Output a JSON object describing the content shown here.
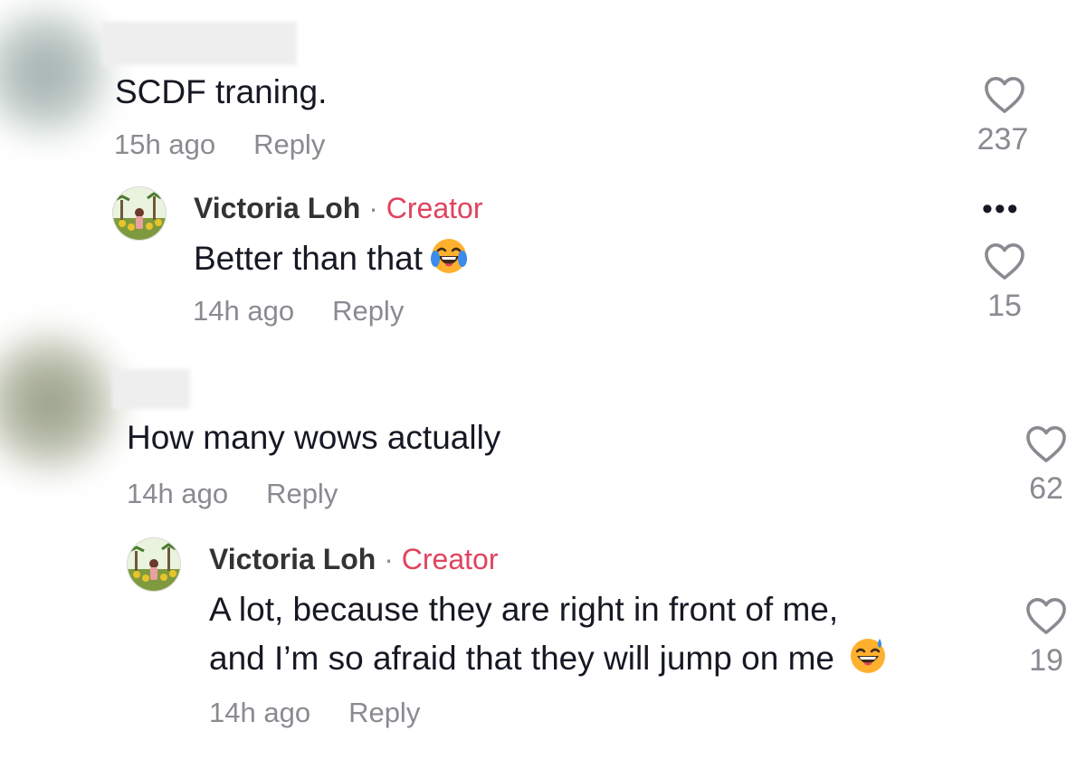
{
  "comments": [
    {
      "text": "SCDF traning.",
      "time": "15h ago",
      "reply_label": "Reply",
      "likes": "237",
      "replies": [
        {
          "author": "Victoria Loh",
          "separator": "·",
          "badge": "Creator",
          "text": "Better than that",
          "emoji": "face-with-tears-of-joy",
          "time": "14h ago",
          "reply_label": "Reply",
          "likes": "15",
          "more": "•••"
        }
      ]
    },
    {
      "text": "How many wows actually",
      "time": "14h ago",
      "reply_label": "Reply",
      "likes": "62",
      "replies": [
        {
          "author": "Victoria Loh",
          "separator": "·",
          "badge": "Creator",
          "text_line1": "A lot, because they are right in front of me,",
          "text_line2": "and I’m so afraid that they will jump on me",
          "emoji": "grinning-face-with-sweat",
          "time": "14h ago",
          "reply_label": "Reply",
          "likes": "19"
        }
      ]
    }
  ],
  "colors": {
    "creator_badge": "#e0435e",
    "meta_gray": "#8a8b91",
    "emoji_yellow": "#ffb02e"
  }
}
